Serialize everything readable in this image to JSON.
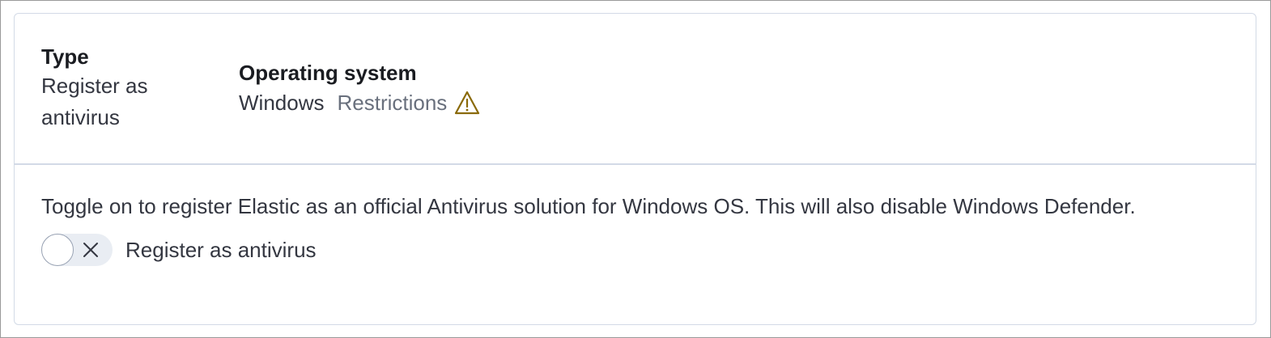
{
  "header": {
    "type_title": "Type",
    "type_value": "Register as antivirus",
    "os_title": "Operating system",
    "os_value": "Windows",
    "restrictions_label": "Restrictions",
    "restrictions_icon": "warning-icon",
    "warning_color": "#8a6a0a"
  },
  "body": {
    "description": "Toggle on to register Elastic as an official Antivirus solution for Windows OS. This will also disable Windows Defender.",
    "toggle": {
      "label": "Register as antivirus",
      "state": "off",
      "icon": "cross-icon"
    }
  }
}
